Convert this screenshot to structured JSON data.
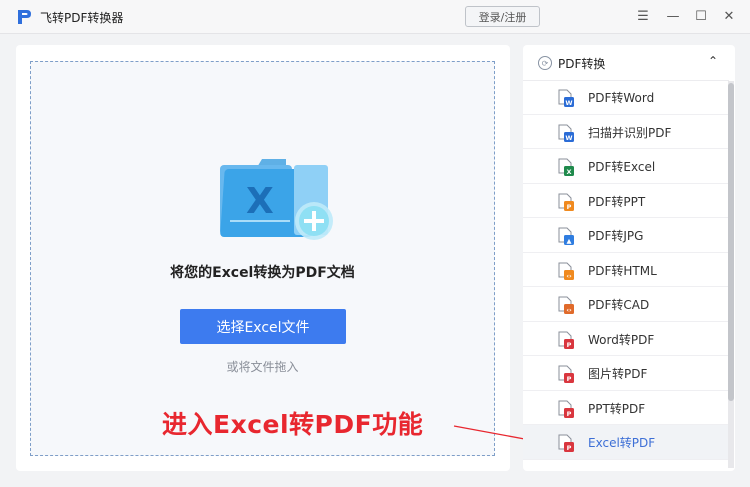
{
  "app": {
    "title": "飞转PDF转换器"
  },
  "titlebar": {
    "login_label": "登录/注册",
    "menu_glyph": "☰",
    "minimize_glyph": "—",
    "maximize_glyph": "☐",
    "close_glyph": "✕"
  },
  "main": {
    "prompt": "将您的Excel转换为PDF文档",
    "select_button": "选择Excel文件",
    "drag_hint": "或将文件拖入"
  },
  "annotation": {
    "text": "进入Excel转PDF功能"
  },
  "sidebar": {
    "header": "PDF转换",
    "header_icon_glyph": "⟳",
    "chevron_glyph": "⌃",
    "items": [
      {
        "label": "PDF转Word",
        "icon": "word-file-icon",
        "color": "#2b6cd6",
        "badge": "W"
      },
      {
        "label": "扫描并识别PDF",
        "icon": "word-file-icon",
        "color": "#2b6cd6",
        "badge": "W"
      },
      {
        "label": "PDF转Excel",
        "icon": "excel-file-icon",
        "color": "#1f8a4c",
        "badge": "X"
      },
      {
        "label": "PDF转PPT",
        "icon": "ppt-file-icon",
        "color": "#f08a1f",
        "badge": "P"
      },
      {
        "label": "PDF转JPG",
        "icon": "image-file-icon",
        "color": "#2f7de0",
        "badge": "▲"
      },
      {
        "label": "PDF转HTML",
        "icon": "html-file-icon",
        "color": "#f08a1f",
        "badge": "‹›"
      },
      {
        "label": "PDF转CAD",
        "icon": "cad-file-icon",
        "color": "#e06a2a",
        "badge": "‹›"
      },
      {
        "label": "Word转PDF",
        "icon": "pdf-file-icon",
        "color": "#d9363e",
        "badge": "P"
      },
      {
        "label": "图片转PDF",
        "icon": "pdf-file-icon",
        "color": "#d9363e",
        "badge": "P"
      },
      {
        "label": "PPT转PDF",
        "icon": "pdf-file-icon",
        "color": "#d9363e",
        "badge": "P"
      },
      {
        "label": "Excel转PDF",
        "icon": "pdf-file-icon",
        "color": "#d9363e",
        "badge": "P",
        "active": true
      }
    ]
  },
  "colors": {
    "accent": "#3d7bef",
    "annotation": "#e8272f",
    "active_item_text": "#3d6fd6"
  }
}
